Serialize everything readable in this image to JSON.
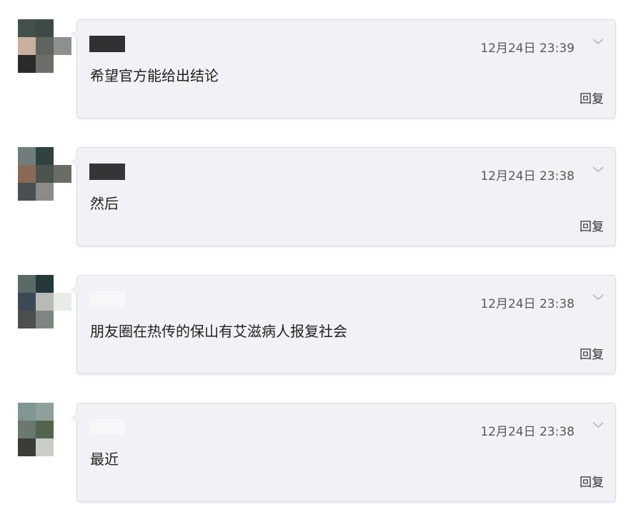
{
  "comments": [
    {
      "avatar_tiles": [
        "#44504c",
        "#3e4a46",
        "#ffffff",
        "#c9b19f",
        "#5f6461",
        "#8d918d",
        "#2a2c2a",
        "#6b6f6a",
        "#ffffff"
      ],
      "username_block": "#2f3132",
      "timestamp": "12月24日 23:39",
      "content": "希望官方能给出结论",
      "reply_label": "回复"
    },
    {
      "avatar_tiles": [
        "#6f7e7c",
        "#2f4240",
        "#ffffff",
        "#8a6a55",
        "#4c524d",
        "#6a6d66",
        "#4a4f52",
        "#8c8b89",
        "#ffffff"
      ],
      "username_block": "#333536",
      "timestamp": "12月24日 23:38",
      "content": "然后",
      "reply_label": "回复"
    },
    {
      "avatar_tiles": [
        "#5a6a66",
        "#25383a",
        "#ffffff",
        "#3b4a55",
        "#b8bab6",
        "#e8ebe6",
        "#4b4f4d",
        "#7f8682",
        "#ffffff"
      ],
      "username_block": "#f7f7f9",
      "timestamp": "12月24日 23:38",
      "content": "朋友圈在热传的保山有艾滋病人报复社会",
      "reply_label": "回复"
    },
    {
      "avatar_tiles": [
        "#7f9693",
        "#8f9f9c",
        "#ffffff",
        "#6a7870",
        "#53664d",
        "#ffffff",
        "#3a3d36",
        "#c9ccc7",
        "#ffffff"
      ],
      "username_block": "#f7f7f9",
      "timestamp": "12月24日 23:38",
      "content": "最近",
      "reply_label": "回复"
    }
  ],
  "colors": {
    "bubble_bg": "#f2f1f5",
    "bubble_border": "#dcdbe0",
    "chevron": "#b5b5b8",
    "timestamp_text": "#5a5a5a",
    "content_text": "#222222"
  },
  "icons": {
    "chevron": "chevron-down-icon"
  }
}
